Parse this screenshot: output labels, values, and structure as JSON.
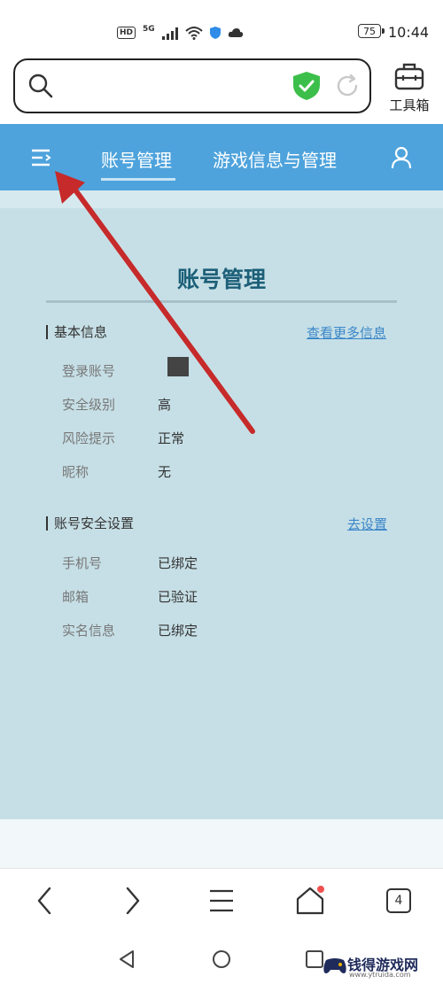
{
  "status_bar": {
    "hd": "HD",
    "network": "5G",
    "battery": "75",
    "time": "10:44"
  },
  "search": {
    "value": "",
    "placeholder": ""
  },
  "toolbox": {
    "label": "工具箱"
  },
  "nav": {
    "tabs": [
      {
        "label": "账号管理",
        "active": true
      },
      {
        "label": "游戏信息与管理",
        "active": false
      }
    ]
  },
  "page": {
    "title": "账号管理",
    "basic_info": {
      "heading": "基本信息",
      "link": "查看更多信息",
      "rows": [
        {
          "label": "登录账号",
          "value": ""
        },
        {
          "label": "安全级别",
          "value": "高"
        },
        {
          "label": "风险提示",
          "value": "正常"
        },
        {
          "label": "昵称",
          "value": "无"
        }
      ]
    },
    "security": {
      "heading": "账号安全设置",
      "link": "去设置",
      "rows": [
        {
          "label": "手机号",
          "value": "已绑定"
        },
        {
          "label": "邮箱",
          "value": "已验证"
        },
        {
          "label": "实名信息",
          "value": "已绑定"
        }
      ]
    }
  },
  "bottom_bar": {
    "tab_count": "4"
  },
  "watermark": {
    "text": "钱得游戏网",
    "url": "www.ytruida.com"
  },
  "colors": {
    "nav_blue": "#4ea3dc",
    "content_bg": "#c6dfe6",
    "title": "#1c5f78",
    "link": "#3a86c8",
    "arrow": "#c62a2a",
    "shield": "#3cbf4a"
  }
}
